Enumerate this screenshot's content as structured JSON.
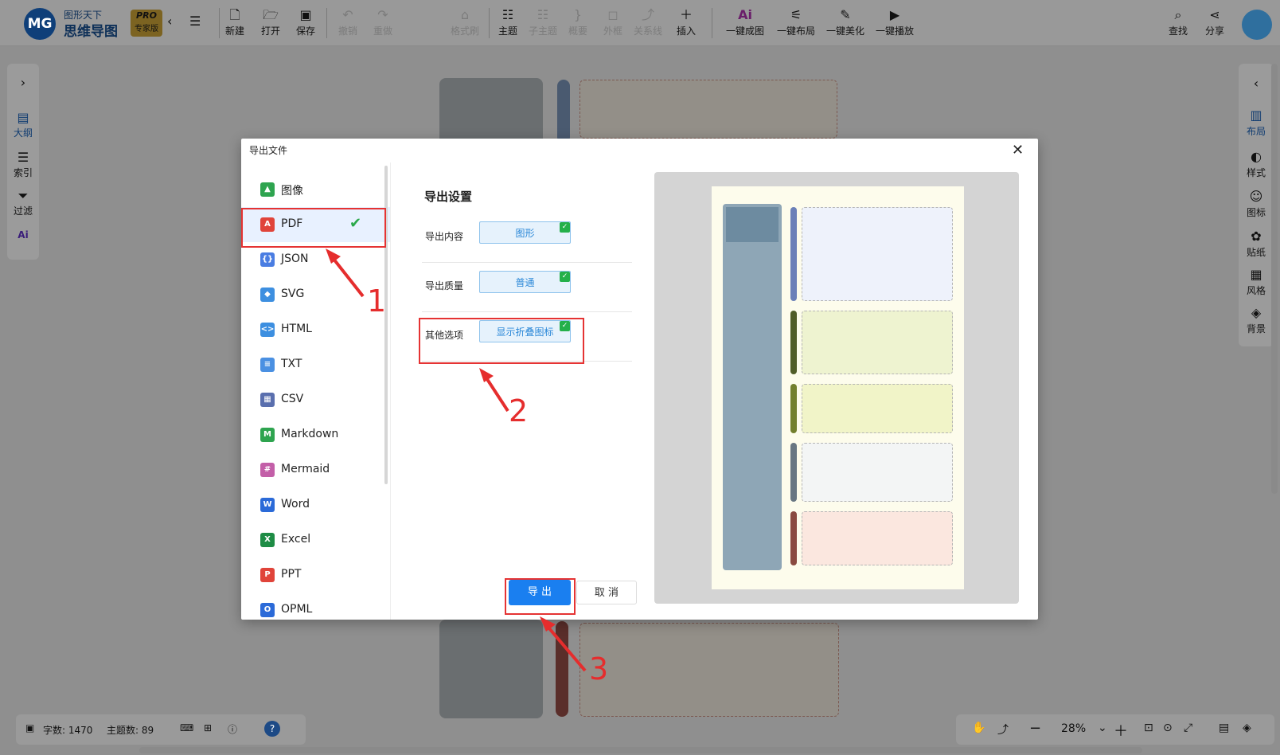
{
  "app": {
    "logo_text": "MG",
    "logo_sub": "图形天下",
    "logo_name": "思维导图",
    "badge_pro": "PRO",
    "badge_edition": "专家版"
  },
  "toolbar": {
    "new": "新建",
    "open": "打开",
    "save": "保存",
    "undo": "撤销",
    "redo": "重做",
    "format_painter": "格式刷",
    "topic": "主题",
    "subtopic": "子主题",
    "summary": "概要",
    "frame": "外框",
    "relation": "关系线",
    "insert": "插入",
    "ai_map": "一键成图",
    "ai_layout": "一键布局",
    "ai_beautify": "一键美化",
    "ai_play": "一键播放",
    "find": "查找",
    "share": "分享"
  },
  "left_panel": {
    "outline": "大纲",
    "index": "索引",
    "filter": "过滤",
    "ai": "Ai"
  },
  "right_panel": {
    "layout": "布局",
    "style": "样式",
    "icon": "图标",
    "sticker": "贴纸",
    "theme": "风格",
    "background": "背景"
  },
  "status": {
    "word_count": "字数: 1470",
    "topic_count": "主题数: 89"
  },
  "zoom": {
    "level": "28%"
  },
  "dialog": {
    "title": "导出文件",
    "formats": [
      {
        "label": "图像",
        "color": "#2ea44f",
        "glyph": "▲"
      },
      {
        "label": "PDF",
        "color": "#e0443a",
        "glyph": "A"
      },
      {
        "label": "JSON",
        "color": "#4a7de2",
        "glyph": "{}"
      },
      {
        "label": "SVG",
        "color": "#3d8fe0",
        "glyph": "◆"
      },
      {
        "label": "HTML",
        "color": "#3d8fe0",
        "glyph": "<>"
      },
      {
        "label": "TXT",
        "color": "#4a90e2",
        "glyph": "≡"
      },
      {
        "label": "CSV",
        "color": "#5a6fae",
        "glyph": "▦"
      },
      {
        "label": "Markdown",
        "color": "#2ea44f",
        "glyph": "M"
      },
      {
        "label": "Mermaid",
        "color": "#c35fa8",
        "glyph": "#"
      },
      {
        "label": "Word",
        "color": "#2b6ad8",
        "glyph": "W"
      },
      {
        "label": "Excel",
        "color": "#1e8c45",
        "glyph": "X"
      },
      {
        "label": "PPT",
        "color": "#e0443a",
        "glyph": "P"
      },
      {
        "label": "OPML",
        "color": "#2b6ad8",
        "glyph": "O"
      }
    ],
    "selected_format": "PDF",
    "settings_title": "导出设置",
    "content_label": "导出内容",
    "content_value": "图形",
    "quality_label": "导出质量",
    "quality_value": "普通",
    "other_label": "其他选项",
    "other_value": "显示折叠图标",
    "export_button": "导 出",
    "cancel_button": "取 消"
  },
  "annotations": [
    "1",
    "2",
    "3"
  ]
}
